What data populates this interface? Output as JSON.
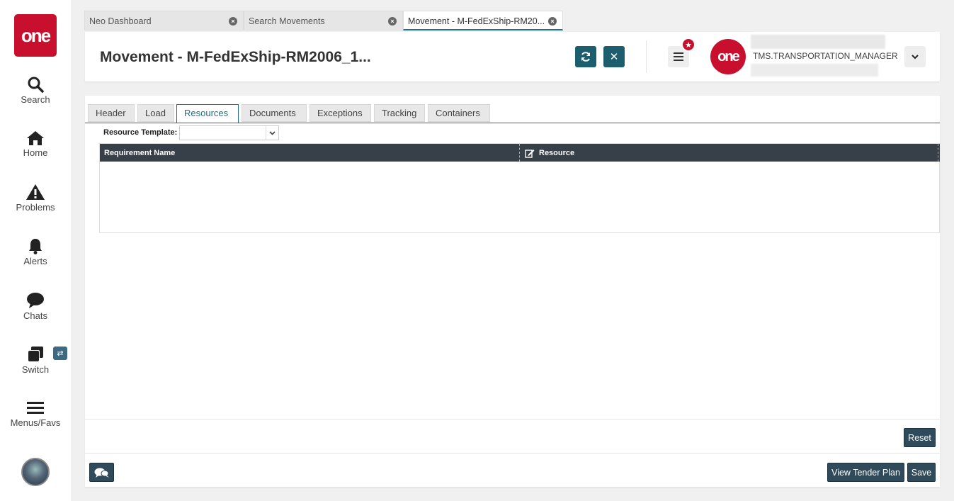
{
  "rail": {
    "logo": "one",
    "items": [
      {
        "label": "Search",
        "icon": "search-icon"
      },
      {
        "label": "Home",
        "icon": "home-icon"
      },
      {
        "label": "Problems",
        "icon": "warning-icon"
      },
      {
        "label": "Alerts",
        "icon": "bell-icon"
      },
      {
        "label": "Chats",
        "icon": "chat-icon"
      },
      {
        "label": "Switch",
        "icon": "switch-icon"
      },
      {
        "label": "Menus/Favs",
        "icon": "hamburger-icon"
      }
    ],
    "switch_badge": "⇄"
  },
  "tabs": [
    {
      "label": "Neo Dashboard"
    },
    {
      "label": "Search Movements"
    },
    {
      "label": "Movement - M-FedExShip-RM20...",
      "active": true
    }
  ],
  "header": {
    "title": "Movement - M-FedExShip-RM2006_1...",
    "role": "TMS.TRANSPORTATION_MANAGER",
    "user_logo": "one"
  },
  "subtabs": [
    "Header",
    "Load",
    "Resources",
    "Documents",
    "Exceptions",
    "Tracking",
    "Containers"
  ],
  "form": {
    "resource_template_label": "Resource Template:",
    "resource_template_value": ""
  },
  "grid": {
    "columns": [
      "Requirement Name",
      "Resource"
    ],
    "rows": []
  },
  "buttons": {
    "reset": "Reset",
    "view_tender_plan": "View Tender Plan",
    "save": "Save"
  },
  "colors": {
    "brand_red": "#c8102e",
    "accent_teal": "#1d5e6e",
    "grid_header": "#373f48"
  }
}
